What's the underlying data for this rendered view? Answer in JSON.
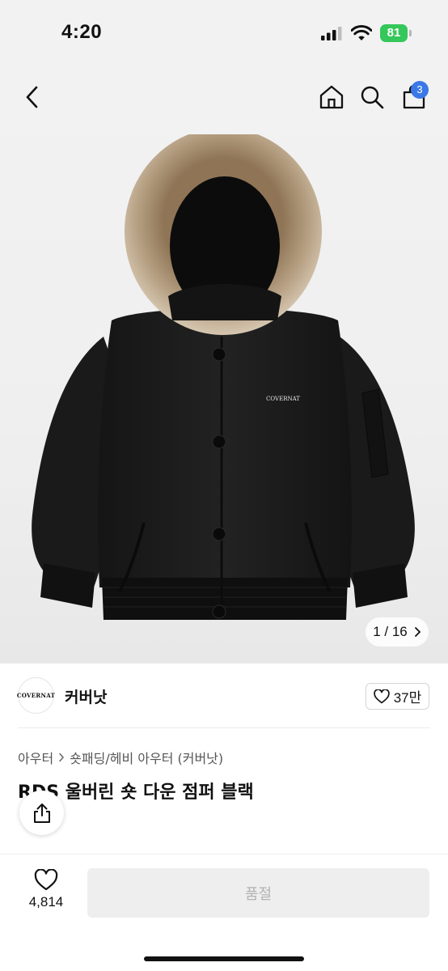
{
  "status_bar": {
    "time": "4:20",
    "battery": "81",
    "battery_color": "#34c759"
  },
  "header": {
    "icons": [
      "back-icon",
      "home-icon",
      "search-icon",
      "cart-icon"
    ],
    "cart_badge": "3",
    "badge_color": "#3a78e8"
  },
  "gallery": {
    "pager": "1 / 16",
    "chest_logo": "COVERNAT"
  },
  "brand": {
    "logo_text": "COVERNAT",
    "name": "커버낫",
    "likes": "37만"
  },
  "breadcrumb": {
    "category": "아우터",
    "subcategory": "숏패딩/헤비 아우터 (커버낫)"
  },
  "product": {
    "title": "RDS 울버린 숏 다운 점퍼 블랙"
  },
  "bottom_bar": {
    "wish_count": "4,814",
    "buy_label": "품절"
  }
}
